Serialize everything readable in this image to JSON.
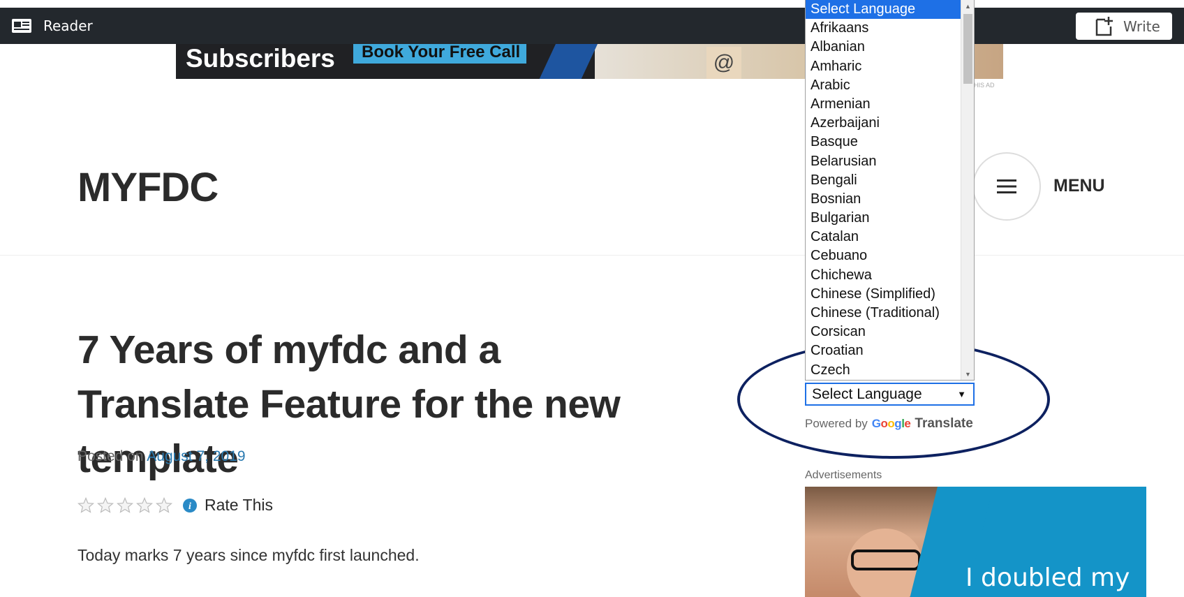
{
  "masterbar": {
    "reader_label": "Reader",
    "write_label": "Write"
  },
  "ad_banner": {
    "headline": "Subscribers",
    "cta": "Book Your Free Call",
    "report": "HIS AD"
  },
  "site": {
    "title": "MYFDC",
    "menu_label": "MENU"
  },
  "post": {
    "title": "7 Years of myfdc and a Translate Feature for the new template",
    "posted_prefix": "Posted on",
    "date": "August 7, 2019",
    "rating_label": "Rate This",
    "rating_stars": 0,
    "rating_max": 5,
    "body": "Today marks 7 years since myfdc first launched."
  },
  "translate": {
    "options": [
      "Select Language",
      "Afrikaans",
      "Albanian",
      "Amharic",
      "Arabic",
      "Armenian",
      "Azerbaijani",
      "Basque",
      "Belarusian",
      "Bengali",
      "Bosnian",
      "Bulgarian",
      "Catalan",
      "Cebuano",
      "Chichewa",
      "Chinese (Simplified)",
      "Chinese (Traditional)",
      "Corsican",
      "Croatian",
      "Czech"
    ],
    "selected": "Select Language",
    "powered_by": "Powered by",
    "google": [
      "G",
      "o",
      "o",
      "g",
      "l",
      "e"
    ],
    "translate_word": "Translate",
    "highlight_color": "#0d2160",
    "selected_color": "#1e70e6"
  },
  "sidebar": {
    "ads_label": "Advertisements",
    "ad_text": "I doubled my"
  }
}
